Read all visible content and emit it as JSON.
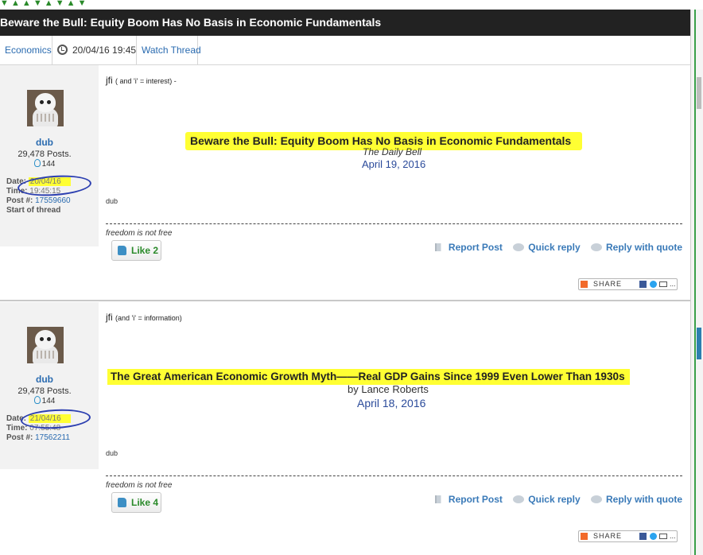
{
  "ticker": "  ▼   ▲   ▲   ▼   ▲   ▼   ▲   ▼",
  "thread_title": "Beware the Bull: Equity Boom Has No Basis in Economic Fundamentals",
  "nav": {
    "forum": "Economics",
    "date": "20/04/16 19:45",
    "watch": "Watch Thread"
  },
  "posts": [
    {
      "user": "dub",
      "posts_count": "29,478 Posts.",
      "rep": "144",
      "date_label": "Date:",
      "date": "20/04/16",
      "time_label": "Time:",
      "time": "19:45:15",
      "postnum_label": "Post #:",
      "postnum": "17559660",
      "extra": "Start of thread",
      "jfi": "jfi",
      "jfi_note": "( and 'i' = interest) -",
      "headline": "Beware the Bull: Equity Boom Has No Basis in Economic Fundamentals",
      "source": "The Daily Bell",
      "date_line": "April 19, 2016",
      "sig": "dub",
      "freedom": "freedom is not free",
      "like": "Like 2",
      "report": "Report Post",
      "quick": "Quick reply",
      "quote": "Reply with quote",
      "share": "SHARE",
      "more": "..."
    },
    {
      "user": "dub",
      "posts_count": "29,478 Posts.",
      "rep": "144",
      "date_label": "Date:",
      "date": "21/04/16",
      "time_label": "Time:",
      "time": "07:55:48",
      "postnum_label": "Post #:",
      "postnum": "17562211",
      "jfi": "jfi",
      "jfi_note": "(and 'i' = information)",
      "headline": "The Great American Economic Growth Myth——Real GDP Gains Since 1999 Even Lower Than 1930s",
      "source": "by Lance Roberts",
      "date_line": "April 18, 2016",
      "sig": "dub",
      "freedom": "freedom is not free",
      "like": "Like 4",
      "report": "Report Post",
      "quick": "Quick reply",
      "quote": "Reply with quote",
      "share": "SHARE",
      "more": "..."
    }
  ],
  "colors": {
    "highlight": "#ffff33",
    "link": "#2a6bb0",
    "title_bg": "#222222",
    "like_green": "#2a8a2a"
  }
}
